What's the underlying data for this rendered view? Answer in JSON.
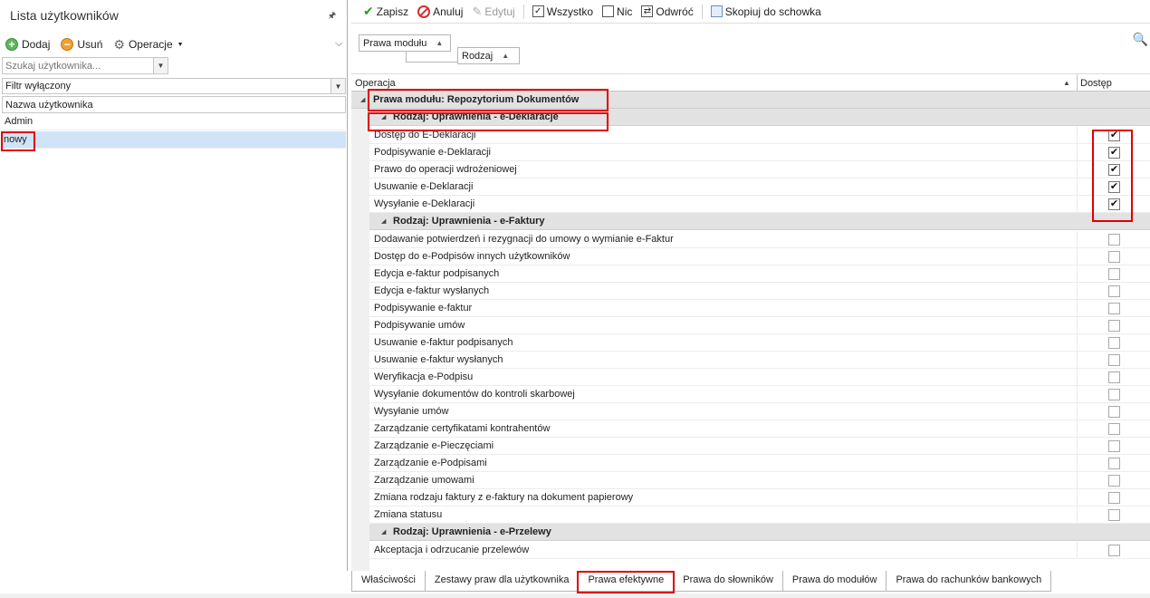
{
  "left_panel": {
    "title": "Lista użytkowników",
    "toolbar": {
      "add_label": "Dodaj",
      "remove_label": "Usuń",
      "operations_label": "Operacje"
    },
    "search": {
      "placeholder": "Szukaj użytkownika..."
    },
    "filter": {
      "value": "Filtr wyłączony"
    },
    "column_header": "Nazwa użytkownika",
    "users": [
      "Admin",
      "nowy"
    ],
    "selected_user": "nowy"
  },
  "toolbar": {
    "save": "Zapisz",
    "cancel": "Anuluj",
    "edit": "Edytuj",
    "all": "Wszystko",
    "none": "Nic",
    "invert": "Odwróć",
    "copy": "Skopiuj do schowka"
  },
  "group_panel": {
    "chip1": "Prawa modułu",
    "chip2": "Rodzaj"
  },
  "grid": {
    "col_operation": "Operacja",
    "col_access": "Dostęp",
    "module_group": "Prawa modułu: Repozytorium Dokumentów",
    "groups": [
      {
        "label": "Rodzaj: Uprawnienia - e-Deklaracje",
        "rows": [
          {
            "name": "Dostęp do E-Deklaracji",
            "checked": true
          },
          {
            "name": "Podpisywanie e-Deklaracji",
            "checked": true
          },
          {
            "name": "Prawo do operacji wdrożeniowej",
            "checked": true
          },
          {
            "name": "Usuwanie e-Deklaracji",
            "checked": true
          },
          {
            "name": "Wysyłanie e-Deklaracji",
            "checked": true
          }
        ]
      },
      {
        "label": "Rodzaj: Uprawnienia - e-Faktury",
        "rows": [
          {
            "name": "Dodawanie potwierdzeń i rezygnacji do umowy o wymianie e-Faktur",
            "checked": false
          },
          {
            "name": "Dostęp do e-Podpisów innych użytkowników",
            "checked": false
          },
          {
            "name": "Edycja e-faktur podpisanych",
            "checked": false
          },
          {
            "name": "Edycja e-faktur wysłanych",
            "checked": false
          },
          {
            "name": "Podpisywanie e-faktur",
            "checked": false
          },
          {
            "name": "Podpisywanie umów",
            "checked": false
          },
          {
            "name": "Usuwanie e-faktur podpisanych",
            "checked": false
          },
          {
            "name": "Usuwanie e-faktur wysłanych",
            "checked": false
          },
          {
            "name": "Weryfikacja e-Podpisu",
            "checked": false
          },
          {
            "name": "Wysyłanie dokumentów do kontroli skarbowej",
            "checked": false
          },
          {
            "name": "Wysyłanie umów",
            "checked": false
          },
          {
            "name": "Zarządzanie certyfikatami kontrahentów",
            "checked": false
          },
          {
            "name": "Zarządzanie e-Pieczęciami",
            "checked": false
          },
          {
            "name": "Zarządzanie e-Podpisami",
            "checked": false
          },
          {
            "name": "Zarządzanie umowami",
            "checked": false
          },
          {
            "name": "Zmiana rodzaju faktury z e-faktury na dokument papierowy",
            "checked": false
          },
          {
            "name": "Zmiana statusu",
            "checked": false
          }
        ]
      },
      {
        "label": "Rodzaj: Uprawnienia - e-Przelewy",
        "rows": [
          {
            "name": "Akceptacja i odrzucanie przelewów",
            "checked": false
          }
        ]
      }
    ]
  },
  "tabs": [
    "Właściwości",
    "Zestawy praw dla użytkownika",
    "Prawa efektywne",
    "Prawa do słowników",
    "Prawa do modułów",
    "Prawa do rachunków bankowych"
  ],
  "active_tab": "Prawa efektywne",
  "colors": {
    "highlight": "#e00000",
    "selection": "#cfe4f6",
    "group_bg": "#e2e2e2",
    "accent_green": "#2b9a2b"
  }
}
